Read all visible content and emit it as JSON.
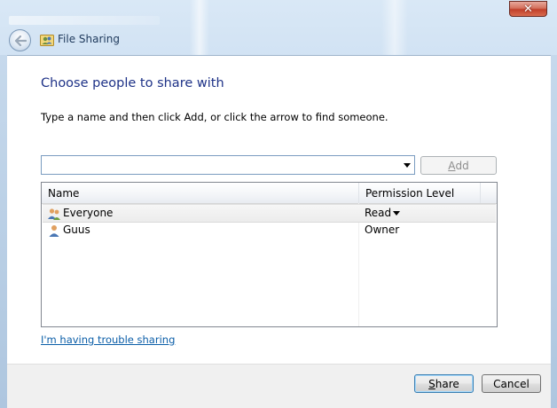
{
  "window": {
    "title": "File Sharing",
    "close_glyph": "✕"
  },
  "icons": {
    "back": "back-arrow-icon",
    "title": "sharing-users-icon",
    "close": "close-icon",
    "everyone": "group-users-icon",
    "user": "user-icon"
  },
  "main": {
    "heading": "Choose people to share with",
    "instructions": "Type a name and then click Add, or click the arrow to find someone.",
    "name_input": {
      "value": "",
      "placeholder": ""
    },
    "add_label_u": "A",
    "add_label_rest": "dd"
  },
  "list": {
    "columns": {
      "name": "Name",
      "permission": "Permission Level"
    },
    "rows": [
      {
        "name": "Everyone",
        "permission": "Read",
        "selected": true
      },
      {
        "name": "Guus",
        "permission": "Owner",
        "selected": false
      }
    ]
  },
  "trouble_link": "I'm having trouble sharing",
  "footer": {
    "share_u": "S",
    "share_rest": "hare",
    "cancel": "Cancel"
  },
  "colors": {
    "heading": "#1e3287",
    "link": "#0b5ea8",
    "close_button": "#c1402b"
  }
}
